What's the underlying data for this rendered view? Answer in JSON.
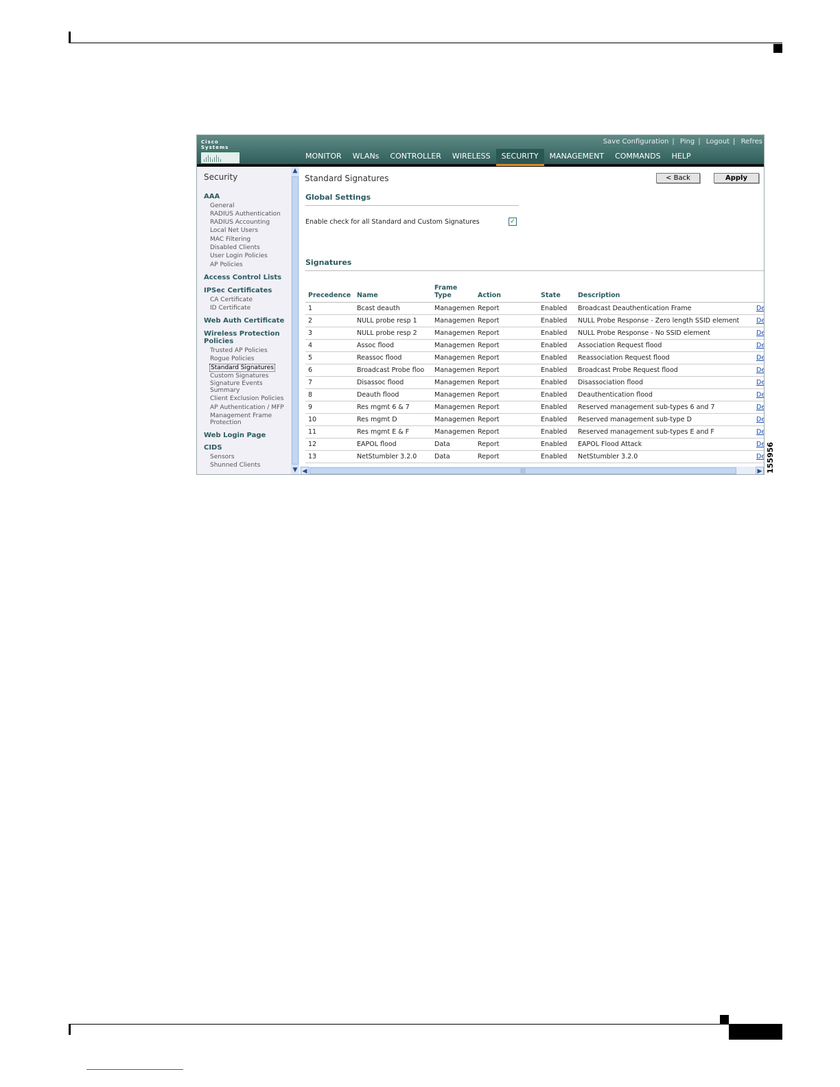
{
  "figure_id": "155956",
  "app": {
    "logo_text": "Cisco Systems",
    "top_links": [
      "Save Configuration",
      "Ping",
      "Logout",
      "Refres"
    ],
    "menu": [
      "MONITOR",
      "WLANs",
      "CONTROLLER",
      "WIRELESS",
      "SECURITY",
      "MANAGEMENT",
      "COMMANDS",
      "HELP"
    ],
    "active_menu": "SECURITY"
  },
  "sidebar": {
    "title": "Security",
    "aaa": "AAA",
    "aaa_items": [
      "General",
      "RADIUS Authentication",
      "RADIUS Accounting",
      "Local Net Users",
      "MAC Filtering",
      "Disabled Clients",
      "User Login Policies",
      "AP Policies"
    ],
    "acl": "Access Control Lists",
    "ipsec": "IPSec Certificates",
    "ipsec_items": [
      "CA Certificate",
      "ID Certificate"
    ],
    "webauth": "Web Auth Certificate",
    "wps": "Wireless Protection Policies",
    "wps_items": [
      "Trusted AP Policies",
      "Rogue Policies",
      "Standard Signatures",
      "Custom Signatures",
      "Signature Events Summary",
      "Client Exclusion Policies",
      "AP Authentication / MFP",
      "Management Frame Protection"
    ],
    "weblogin": "Web Login Page",
    "cids": "CIDS",
    "cids_items": [
      "Sensors",
      "Shunned Clients"
    ]
  },
  "main": {
    "title": "Standard Signatures",
    "back_label": "< Back",
    "apply_label": "Apply",
    "global_settings": "Global Settings",
    "enable_check_label": "Enable check for all Standard and Custom Signatures",
    "enable_check_checked": true,
    "signatures_heading": "Signatures",
    "table": {
      "headers": [
        "Precedence",
        "Name",
        "Frame Type",
        "Action",
        "State",
        "Description",
        ""
      ],
      "rows": [
        [
          "1",
          "Bcast deauth",
          "Managemen",
          "Report",
          "Enabled",
          "Broadcast Deauthentication Frame",
          "De"
        ],
        [
          "2",
          "NULL probe resp 1",
          "Managemen",
          "Report",
          "Enabled",
          "NULL Probe Response - Zero length SSID element",
          "De"
        ],
        [
          "3",
          "NULL probe resp 2",
          "Managemen",
          "Report",
          "Enabled",
          "NULL Probe Response - No SSID element",
          "De"
        ],
        [
          "4",
          "Assoc flood",
          "Managemen",
          "Report",
          "Enabled",
          "Association Request flood",
          "De"
        ],
        [
          "5",
          "Reassoc flood",
          "Managemen",
          "Report",
          "Enabled",
          "Reassociation Request flood",
          "De"
        ],
        [
          "6",
          "Broadcast Probe floo",
          "Managemen",
          "Report",
          "Enabled",
          "Broadcast Probe Request flood",
          "De"
        ],
        [
          "7",
          "Disassoc flood",
          "Managemen",
          "Report",
          "Enabled",
          "Disassociation flood",
          "De"
        ],
        [
          "8",
          "Deauth flood",
          "Managemen",
          "Report",
          "Enabled",
          "Deauthentication flood",
          "De"
        ],
        [
          "9",
          "Res mgmt 6 & 7",
          "Managemen",
          "Report",
          "Enabled",
          "Reserved management sub-types 6 and 7",
          "De"
        ],
        [
          "10",
          "Res mgmt D",
          "Managemen",
          "Report",
          "Enabled",
          "Reserved management sub-type D",
          "De"
        ],
        [
          "11",
          "Res mgmt E & F",
          "Managemen",
          "Report",
          "Enabled",
          "Reserved management sub-types E and F",
          "De"
        ],
        [
          "12",
          "EAPOL flood",
          "Data",
          "Report",
          "Enabled",
          "EAPOL Flood Attack",
          "De"
        ],
        [
          "13",
          "NetStumbler 3.2.0",
          "Data",
          "Report",
          "Enabled",
          "NetStumbler 3.2.0",
          "De"
        ]
      ]
    }
  },
  "colors": {
    "banner": "#2f5e5a",
    "heading": "#2b5b60",
    "active_tab_underline": "#e28a2a",
    "sidebar_bg": "#f1f0f7"
  }
}
